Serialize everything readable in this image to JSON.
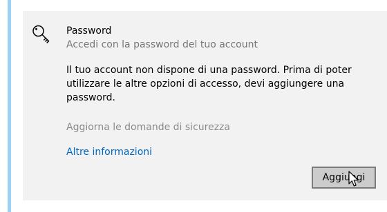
{
  "password_option": {
    "icon": "key-icon",
    "title": "Password",
    "subtitle": "Accedi con la password del tuo account",
    "description": "Il tuo account non dispone di una password. Prima di poter utilizzare le altre opzioni di accesso, devi aggiungere una password.",
    "security_questions_link": "Aggiorna le domande di sicurezza",
    "more_info_link": "Altre informazioni",
    "add_button_label": "Aggiungi"
  },
  "colors": {
    "accent": "#9cd3f4",
    "panel_background": "#f2f2f2",
    "link": "#0067c0",
    "disabled_text": "#8a8a8a",
    "secondary_text": "#767676"
  }
}
